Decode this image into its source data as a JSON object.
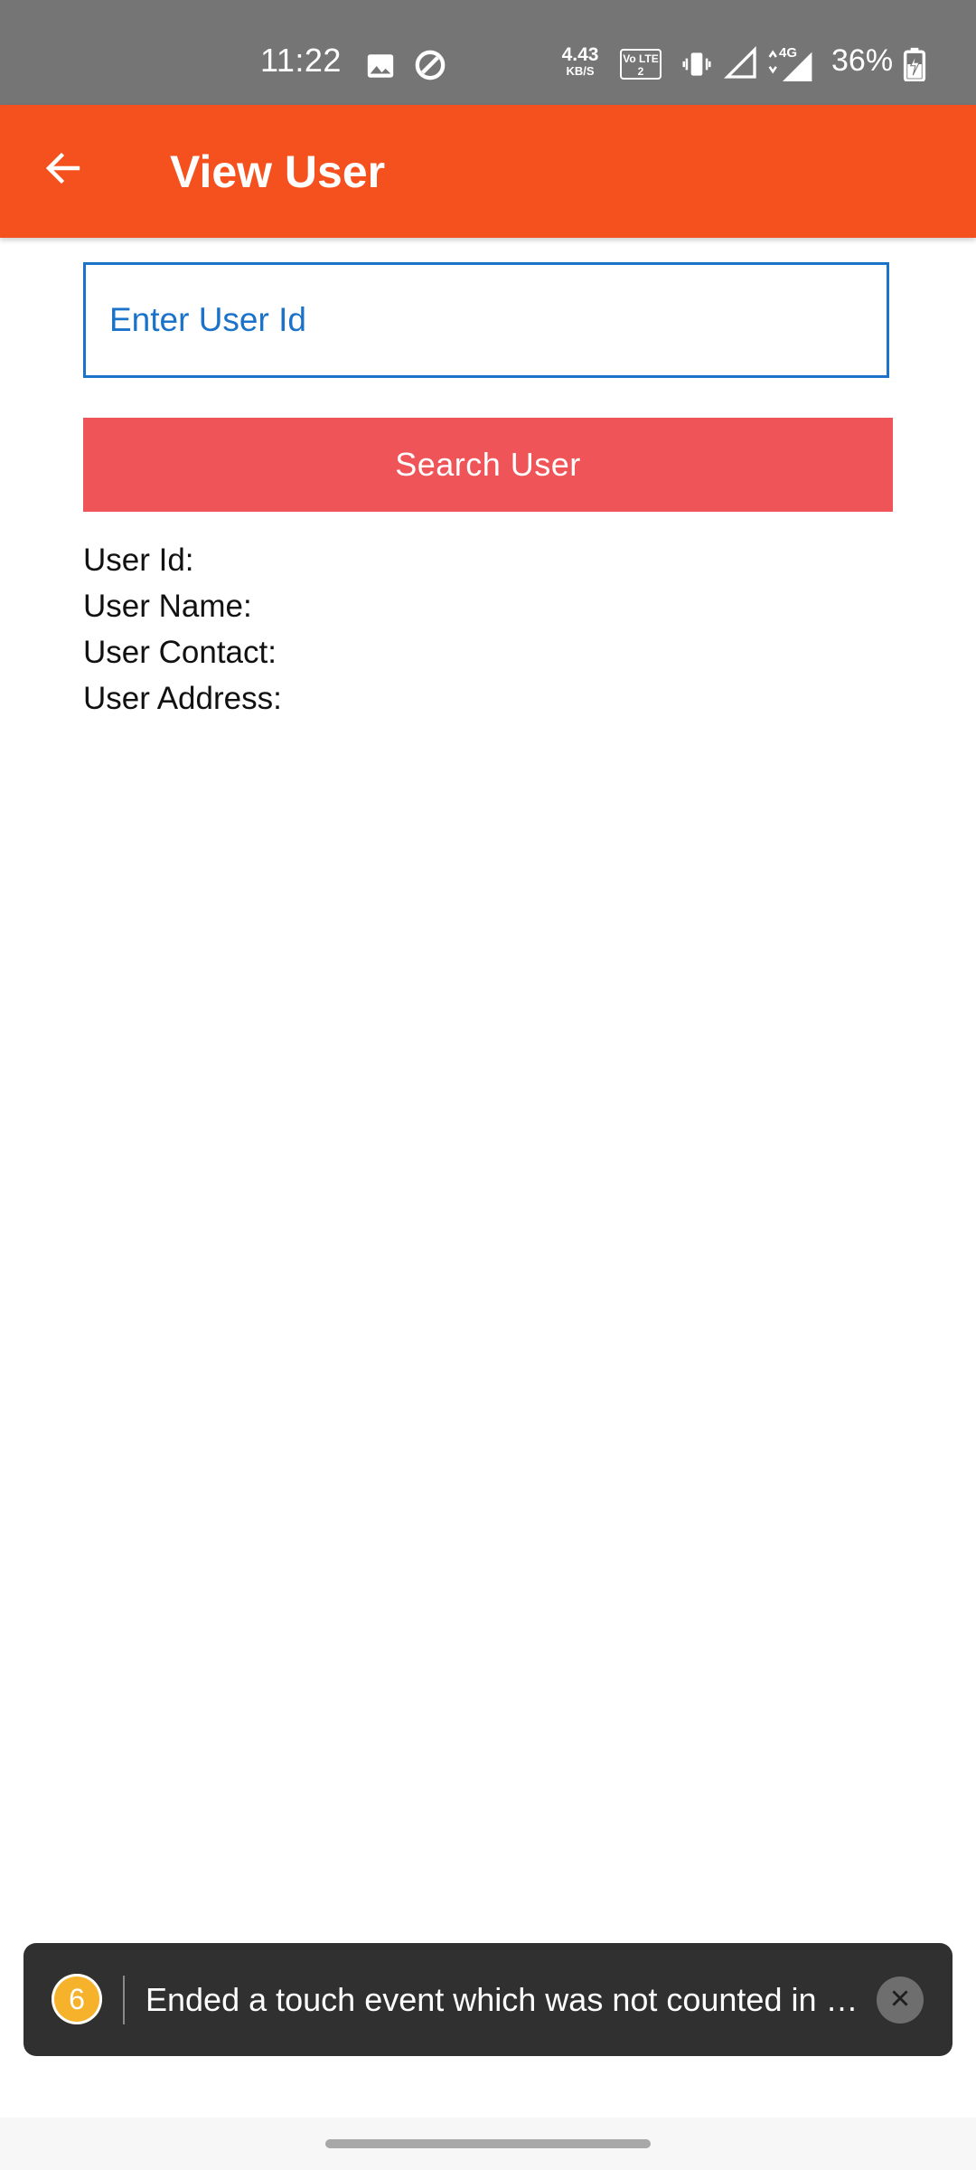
{
  "status_bar": {
    "time": "11:22",
    "net_speed_value": "4.43",
    "net_speed_unit": "KB/S",
    "volte_label": "Vo LTE 2",
    "network_type": "4G",
    "battery_percent": "36%",
    "icons": [
      "gallery-icon",
      "data-saver-icon",
      "vibrate-icon",
      "signal-empty-icon",
      "signal-4g-icon",
      "battery-charging-icon"
    ]
  },
  "app_bar": {
    "back_icon": "arrow-back-icon",
    "title": "View User"
  },
  "form": {
    "user_id_placeholder": "Enter User Id",
    "user_id_value": "",
    "search_button_label": "Search User"
  },
  "details": {
    "user_id_label": "User Id:",
    "user_name_label": "User Name:",
    "user_contact_label": "User Contact:",
    "user_address_label": "User Address:"
  },
  "toast": {
    "badge_count": "6",
    "message": "Ended a touch event which was not counted in …",
    "close_icon": "close-icon"
  },
  "colors": {
    "status_bar": "#757575",
    "app_bar": "#f4511e",
    "input_accent": "#1a73c8",
    "button": "#ef5558",
    "toast_bg": "#303030",
    "badge": "#f6b22b"
  }
}
